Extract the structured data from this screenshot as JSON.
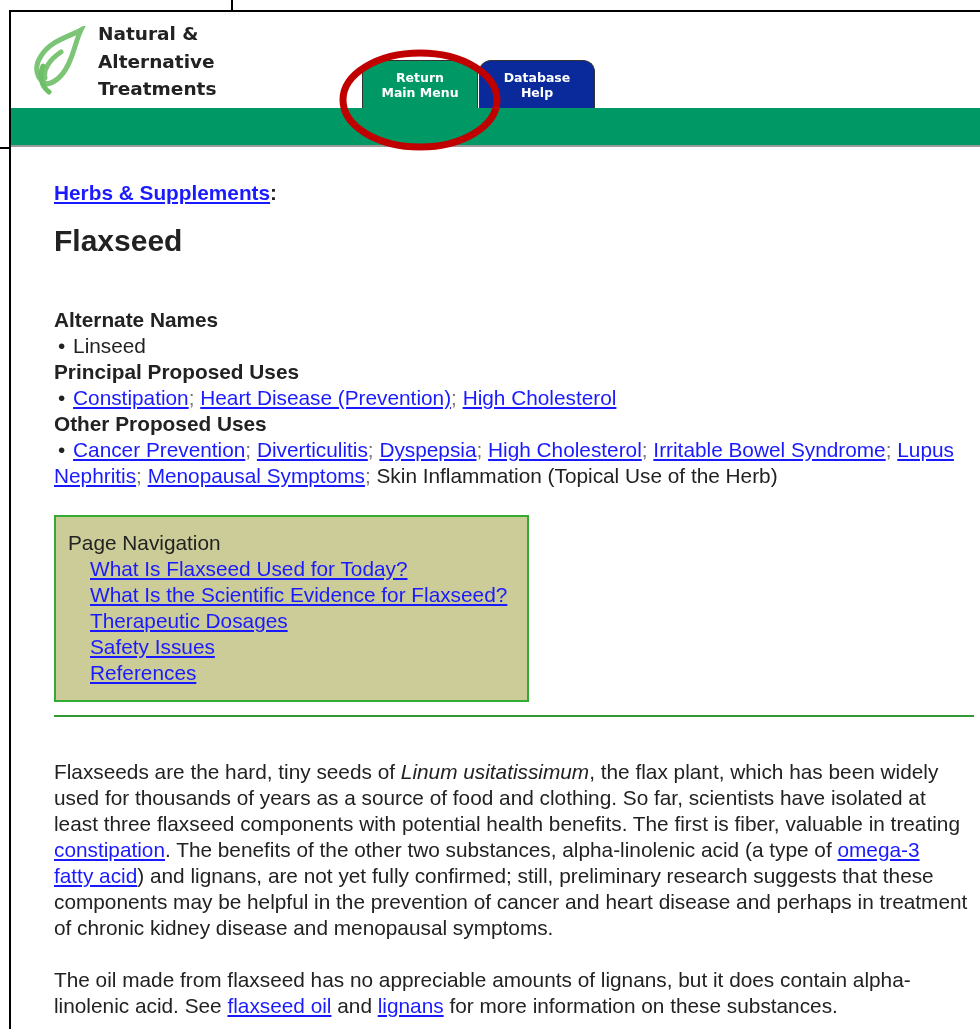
{
  "header": {
    "logo_lines": [
      "Natural &",
      "Alternative",
      "Treatments"
    ],
    "tabs": [
      {
        "lines": [
          "Return",
          "Main Menu"
        ],
        "color": "#009966",
        "circled": true
      },
      {
        "lines": [
          "Database",
          "Help"
        ],
        "color": "#0a2a9c",
        "circled": false
      }
    ]
  },
  "breadcrumb": {
    "link": "Herbs & Supplements",
    "suffix": ":"
  },
  "title": "Flaxseed",
  "sections": [
    {
      "heading": "Alternate Names",
      "bullet": "•",
      "items": [
        {
          "text": "Linseed",
          "link": false
        }
      ]
    },
    {
      "heading": "Principal Proposed Uses",
      "bullet": "•",
      "separator": ";",
      "items": [
        {
          "text": "Constipation",
          "link": true
        },
        {
          "text": "Heart Disease (Prevention)",
          "link": true
        },
        {
          "text": "High Cholesterol",
          "link": true
        }
      ]
    },
    {
      "heading": "Other Proposed Uses",
      "bullet": "•",
      "separator": ";",
      "items": [
        {
          "text": "Cancer Prevention",
          "link": true
        },
        {
          "text": "Diverticulitis",
          "link": true
        },
        {
          "text": "Dyspepsia",
          "link": true
        },
        {
          "text": "High Cholesterol",
          "link": true
        },
        {
          "text": "Irritable Bowel Syndrome",
          "link": true
        },
        {
          "lines": [
            "Lupus",
            "Nephritis"
          ],
          "link": true
        },
        {
          "text": "Menopausal Symptoms",
          "link": true
        },
        {
          "text": "Skin Inflammation (Topical Use of the Herb)",
          "link": false
        }
      ]
    }
  ],
  "page_navigation": {
    "title": "Page Navigation",
    "links": [
      "What Is Flaxseed Used for Today?",
      "What Is the Scientific Evidence for Flaxseed?",
      "Therapeutic Dosages",
      "Safety Issues",
      "References"
    ]
  },
  "paragraphs": [
    [
      {
        "kind": "text",
        "text": "Flaxseeds are the hard, tiny seeds of "
      },
      {
        "kind": "italic",
        "text": "Linum usitatissimum"
      },
      {
        "kind": "text",
        "text": ", the flax plant, which has been widely used for thousands of years as a source of food and clothing. So far, scientists have isolated at least three flaxseed components with potential health benefits. The first is fiber, valuable in treating "
      },
      {
        "kind": "link",
        "text": "constipation"
      },
      {
        "kind": "text",
        "text": ". The benefits of the other two substances, alpha-linolenic acid (a type of "
      },
      {
        "kind": "link",
        "lines": [
          "omega-3",
          "fatty acid"
        ]
      },
      {
        "kind": "text",
        "text": ") and lignans, are not yet fully confirmed; still, preliminary research suggests that these components may be helpful in the prevention of cancer and heart disease and perhaps in treatment of chronic kidney disease and menopausal symptoms."
      }
    ],
    [
      {
        "kind": "text",
        "text": "The oil made from flaxseed has no appreciable amounts of lignans, but it does contain alpha-linolenic acid. See "
      },
      {
        "kind": "link",
        "text": "flaxseed oil"
      },
      {
        "kind": "text",
        "text": " and "
      },
      {
        "kind": "link",
        "text": "lignans"
      },
      {
        "kind": "text",
        "text": " for more information on these substances."
      }
    ]
  ]
}
